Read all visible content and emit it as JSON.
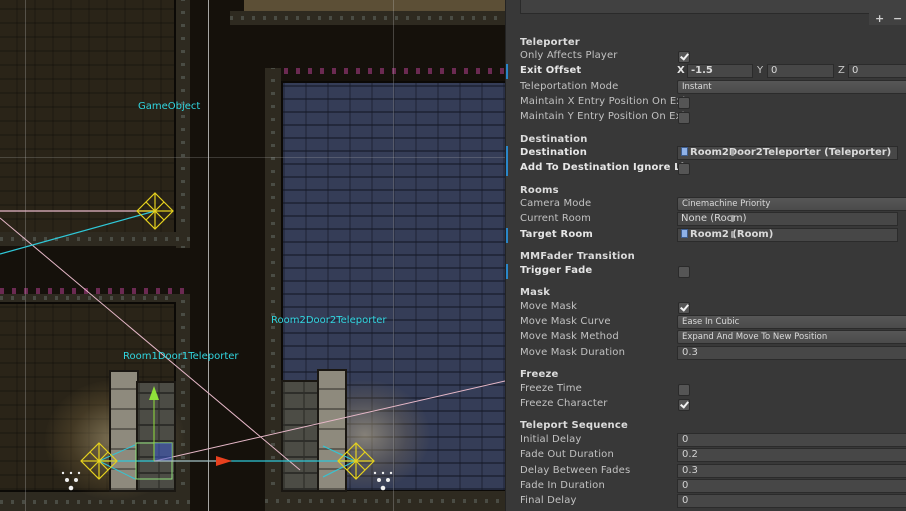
{
  "scene": {
    "labels": {
      "game_object": "GameObject",
      "room1_door1": "Room1Door1Teleporter",
      "room2_door2": "Room2Door2Teleporter"
    },
    "colors": {
      "label": "#31d6e0",
      "gizmo_yellow": "#e6d21e",
      "gizmo_cyan": "#2fc8d8",
      "gizmo_pink": "#e6b8c8",
      "handle_x": "#e8401e",
      "handle_y": "#8fe03a"
    }
  },
  "inspector": {
    "list_footer": {
      "add": "+",
      "remove": "−"
    },
    "sections": {
      "teleporter": {
        "header": "Teleporter",
        "only_affects_player": {
          "label": "Only Affects Player",
          "checked": true
        },
        "exit_offset": {
          "label": "Exit Offset",
          "x_label": "X",
          "x": "-1.5",
          "y_label": "Y",
          "y": "0",
          "z_label": "Z",
          "z": "0"
        },
        "teleportation_mode": {
          "label": "Teleportation Mode",
          "value": "Instant"
        },
        "maintain_x": {
          "label": "Maintain X Entry Position On Exit",
          "checked": false
        },
        "maintain_y": {
          "label": "Maintain Y Entry Position On Exit",
          "checked": false
        }
      },
      "destination": {
        "header": "Destination",
        "destination": {
          "label": "Destination",
          "value": "Room2Door2Teleporter (Teleporter)"
        },
        "add_to_ignore": {
          "label": "Add To Destination Ignore Li",
          "checked": false
        }
      },
      "rooms": {
        "header": "Rooms",
        "camera_mode": {
          "label": "Camera Mode",
          "value": "Cinemachine Priority"
        },
        "current_room": {
          "label": "Current Room",
          "value": "None (Room)"
        },
        "target_room": {
          "label": "Target Room",
          "value": "Room2 (Room)"
        }
      },
      "mmfader": {
        "header": "MMFader Transition",
        "trigger_fade": {
          "label": "Trigger Fade",
          "checked": false
        }
      },
      "mask": {
        "header": "Mask",
        "move_mask": {
          "label": "Move Mask",
          "checked": true
        },
        "move_mask_curve": {
          "label": "Move Mask Curve",
          "value": "Ease In Cubic"
        },
        "move_mask_method": {
          "label": "Move Mask Method",
          "value": "Expand And Move To New Position"
        },
        "move_mask_duration": {
          "label": "Move Mask Duration",
          "value": "0.3"
        }
      },
      "freeze": {
        "header": "Freeze",
        "freeze_time": {
          "label": "Freeze Time",
          "checked": false
        },
        "freeze_character": {
          "label": "Freeze Character",
          "checked": true
        }
      },
      "sequence": {
        "header": "Teleport Sequence",
        "initial_delay": {
          "label": "Initial Delay",
          "value": "0"
        },
        "fade_out_duration": {
          "label": "Fade Out Duration",
          "value": "0.2"
        },
        "delay_between_fades": {
          "label": "Delay Between Fades",
          "value": "0.3"
        },
        "fade_in_duration": {
          "label": "Fade In Duration",
          "value": "0"
        },
        "final_delay": {
          "label": "Final Delay",
          "value": "0"
        }
      }
    }
  }
}
